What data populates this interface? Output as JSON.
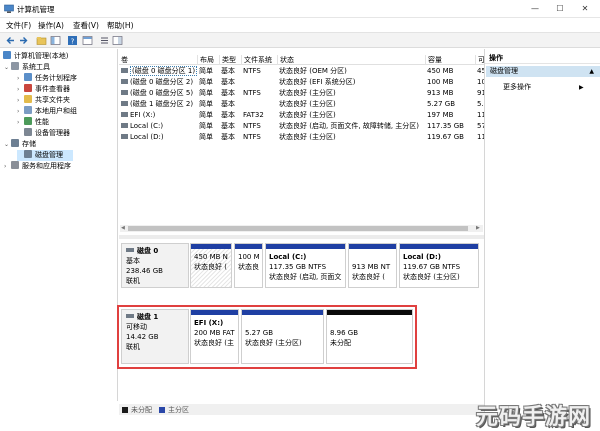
{
  "window": {
    "title": "计算机管理"
  },
  "menu": [
    {
      "label": "文件(F)"
    },
    {
      "label": "操作(A)"
    },
    {
      "label": "查看(V)"
    },
    {
      "label": "帮助(H)"
    }
  ],
  "toolbar": [
    "back-arrow-icon",
    "forward-arrow-icon",
    "folder-up-icon",
    "console-tree-icon",
    "help-icon",
    "properties-icon",
    "disk-tool-icon",
    "panel-icon"
  ],
  "tree": [
    {
      "label": "计算机管理(本地)",
      "level": 0,
      "twisty": "",
      "icon": "computer-icon"
    },
    {
      "label": "系统工具",
      "level": 1,
      "twisty": "⌄",
      "icon": "tools-icon"
    },
    {
      "label": "任务计划程序",
      "level": 2,
      "twisty": "›",
      "icon": "calendar-icon"
    },
    {
      "label": "事件查看器",
      "level": 2,
      "twisty": "›",
      "icon": "event-icon"
    },
    {
      "label": "共享文件夹",
      "level": 2,
      "twisty": "›",
      "icon": "folder-icon"
    },
    {
      "label": "本地用户和组",
      "level": 2,
      "twisty": "›",
      "icon": "users-icon"
    },
    {
      "label": "性能",
      "level": 2,
      "twisty": "›",
      "icon": "performance-icon"
    },
    {
      "label": "设备管理器",
      "level": 2,
      "twisty": "",
      "icon": "device-icon"
    },
    {
      "label": "存储",
      "level": 1,
      "twisty": "⌄",
      "icon": "storage-icon"
    },
    {
      "label": "磁盘管理",
      "level": 2,
      "twisty": "",
      "icon": "disk-icon",
      "selected": true
    },
    {
      "label": "服务和应用程序",
      "level": 1,
      "twisty": "›",
      "icon": "services-icon"
    }
  ],
  "columns": [
    "卷",
    "布局",
    "类型",
    "文件系统",
    "状态",
    "容量",
    "可"
  ],
  "volumes": [
    {
      "name": "(磁盘 0 磁盘分区 1)",
      "layout": "简单",
      "type": "基本",
      "fs": "NTFS",
      "status": "状态良好 (OEM 分区)",
      "capacity": "450 MB",
      "free": "45"
    },
    {
      "name": "(磁盘 0 磁盘分区 2)",
      "layout": "简单",
      "type": "基本",
      "fs": "",
      "status": "状态良好 (EFI 系统分区)",
      "capacity": "100 MB",
      "free": "10"
    },
    {
      "name": "(磁盘 0 磁盘分区 5)",
      "layout": "简单",
      "type": "基本",
      "fs": "NTFS",
      "status": "状态良好 (主分区)",
      "capacity": "913 MB",
      "free": "91"
    },
    {
      "name": "(磁盘 1 磁盘分区 2)",
      "layout": "简单",
      "type": "基本",
      "fs": "",
      "status": "状态良好 (主分区)",
      "capacity": "5.27 GB",
      "free": "5."
    },
    {
      "name": "EFI (X:)",
      "layout": "简单",
      "type": "基本",
      "fs": "FAT32",
      "status": "状态良好 (主分区)",
      "capacity": "197 MB",
      "free": "11"
    },
    {
      "name": "Local (C:)",
      "layout": "简单",
      "type": "基本",
      "fs": "NTFS",
      "status": "状态良好 (启动, 页面文件, 故障转储, 主分区)",
      "capacity": "117.35 GB",
      "free": "57"
    },
    {
      "name": "Local (D:)",
      "layout": "简单",
      "type": "基本",
      "fs": "NTFS",
      "status": "状态良好 (主分区)",
      "capacity": "119.67 GB",
      "free": "11"
    }
  ],
  "disk0": {
    "name": "磁盘 0",
    "type": "基本",
    "size": "238.46 GB",
    "state": "联机",
    "partitions": [
      {
        "title": "",
        "size": "450 MB N",
        "status": "状态良好 (",
        "hatched": true
      },
      {
        "title": "",
        "size": "100 M",
        "status": "状态良",
        "hatched": false
      },
      {
        "title": "Local  (C:)",
        "size": "117.35 GB NTFS",
        "status": "状态良好 (启动, 页面文",
        "hatched": false
      },
      {
        "title": "",
        "size": "913 MB NT",
        "status": "状态良好 (",
        "hatched": false
      },
      {
        "title": "Local  (D:)",
        "size": "119.67 GB NTFS",
        "status": "状态良好 (主分区)",
        "hatched": false
      }
    ]
  },
  "disk1": {
    "name": "磁盘 1",
    "type": "可移动",
    "size": "14.42 GB",
    "state": "联机",
    "partitions": [
      {
        "title": "EFI  (X:)",
        "size": "200 MB FAT",
        "status": "状态良好 (主"
      },
      {
        "title": "",
        "size": "5.27 GB",
        "status": "状态良好 (主分区)"
      },
      {
        "title": "",
        "size": "8.96 GB",
        "status": "未分配"
      }
    ]
  },
  "legend": [
    {
      "label": "未分配",
      "color": "#1a1a1a"
    },
    {
      "label": "主分区",
      "color": "#2a47a8"
    }
  ],
  "actions": {
    "header": "操作",
    "selected": "磁盘管理",
    "more": "更多操作"
  },
  "colors": {
    "primary_bar": "#1f3fa3",
    "unallocated_bar": "#0a0a0a",
    "highlight": "#e0403f"
  },
  "watermark": "元码手游网"
}
